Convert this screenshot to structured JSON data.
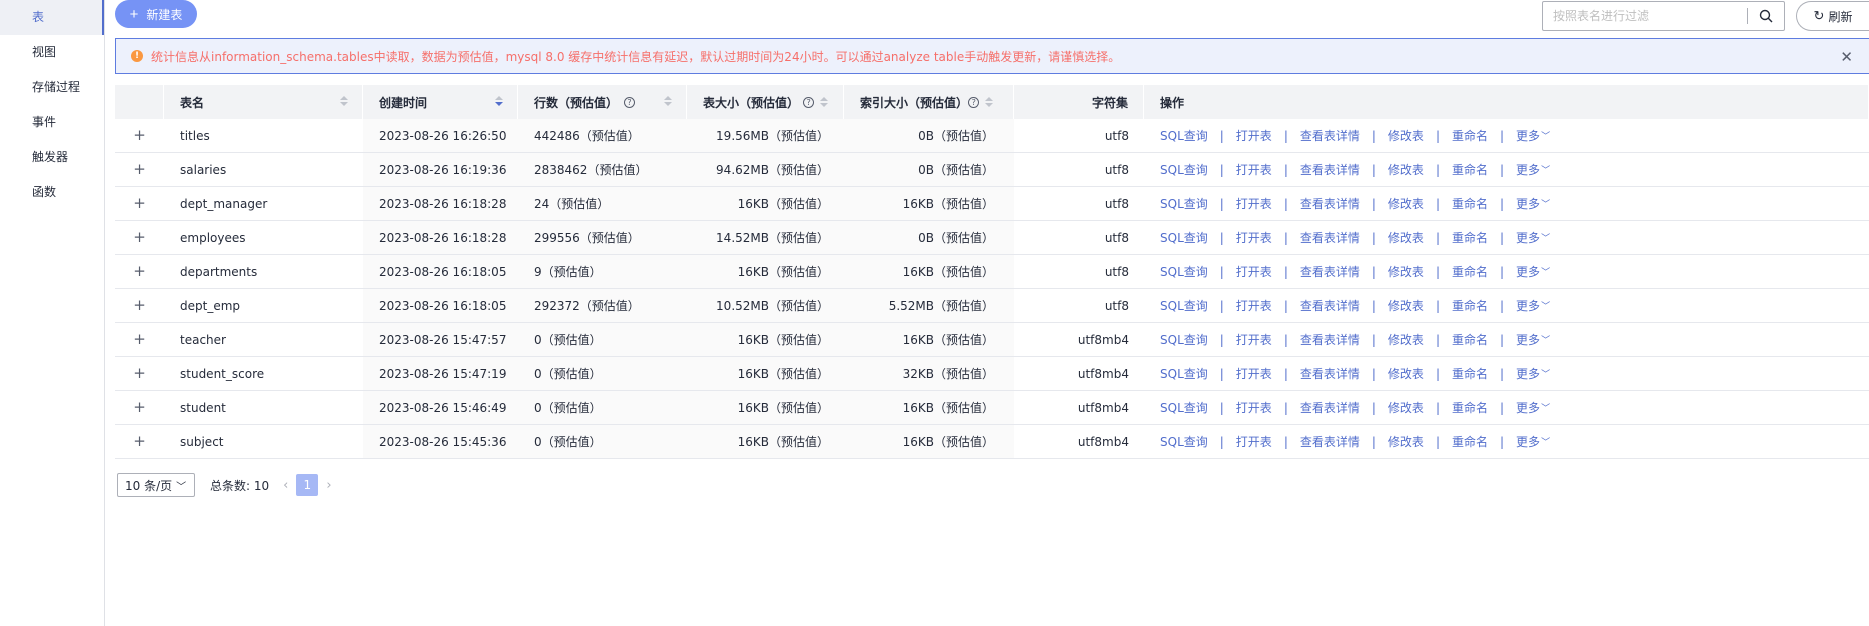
{
  "sidebar": {
    "items": [
      {
        "label": "表",
        "active": true
      },
      {
        "label": "视图",
        "active": false
      },
      {
        "label": "存储过程",
        "active": false
      },
      {
        "label": "事件",
        "active": false
      },
      {
        "label": "触发器",
        "active": false
      },
      {
        "label": "函数",
        "active": false
      }
    ]
  },
  "toolbar": {
    "new_table_label": "新建表",
    "search_placeholder": "按照表名进行过滤",
    "refresh_label": "刷新"
  },
  "alert": {
    "text": "统计信息从information_schema.tables中读取，数据为预估值，mysql 8.0 缓存中统计信息有延迟，默认过期时间为24小时。可以通过analyze table手动触发更新，请谨慎选择。"
  },
  "table": {
    "headers": {
      "name": "表名",
      "created": "创建时间",
      "rows": "行数（预估值）",
      "size": "表大小（预估值）",
      "index_size": "索引大小（预估值）",
      "charset": "字符集",
      "ops": "操作"
    },
    "rows": [
      {
        "name": "titles",
        "created": "2023-08-26 16:26:50",
        "rows": "442486（预估值）",
        "size": "19.56MB（预估值）",
        "index_size": "0B（预估值）",
        "charset": "utf8"
      },
      {
        "name": "salaries",
        "created": "2023-08-26 16:19:36",
        "rows": "2838462（预估值）",
        "size": "94.62MB（预估值）",
        "index_size": "0B（预估值）",
        "charset": "utf8"
      },
      {
        "name": "dept_manager",
        "created": "2023-08-26 16:18:28",
        "rows": "24（预估值）",
        "size": "16KB（预估值）",
        "index_size": "16KB（预估值）",
        "charset": "utf8"
      },
      {
        "name": "employees",
        "created": "2023-08-26 16:18:28",
        "rows": "299556（预估值）",
        "size": "14.52MB（预估值）",
        "index_size": "0B（预估值）",
        "charset": "utf8"
      },
      {
        "name": "departments",
        "created": "2023-08-26 16:18:05",
        "rows": "9（预估值）",
        "size": "16KB（预估值）",
        "index_size": "16KB（预估值）",
        "charset": "utf8"
      },
      {
        "name": "dept_emp",
        "created": "2023-08-26 16:18:05",
        "rows": "292372（预估值）",
        "size": "10.52MB（预估值）",
        "index_size": "5.52MB（预估值）",
        "charset": "utf8"
      },
      {
        "name": "teacher",
        "created": "2023-08-26 15:47:57",
        "rows": "0（预估值）",
        "size": "16KB（预估值）",
        "index_size": "16KB（预估值）",
        "charset": "utf8mb4"
      },
      {
        "name": "student_score",
        "created": "2023-08-26 15:47:19",
        "rows": "0（预估值）",
        "size": "16KB（预估值）",
        "index_size": "32KB（预估值）",
        "charset": "utf8mb4"
      },
      {
        "name": "student",
        "created": "2023-08-26 15:46:49",
        "rows": "0（预估值）",
        "size": "16KB（预估值）",
        "index_size": "16KB（预估值）",
        "charset": "utf8mb4"
      },
      {
        "name": "subject",
        "created": "2023-08-26 15:45:36",
        "rows": "0（预估值）",
        "size": "16KB（预估值）",
        "index_size": "16KB（预估值）",
        "charset": "utf8mb4"
      }
    ],
    "ops": [
      "SQL查询",
      "打开表",
      "查看表详情",
      "修改表",
      "重命名",
      "更多"
    ]
  },
  "pagination": {
    "page_size": "10 条/页",
    "total_label": "总条数:",
    "total": "10",
    "current_page": "1"
  },
  "colors": {
    "primary": "#526ecc",
    "primary_button": "#7693f5",
    "alert_text": "#f66f6a",
    "alert_icon": "#fa9841",
    "alert_bg": "#edf1fc"
  }
}
